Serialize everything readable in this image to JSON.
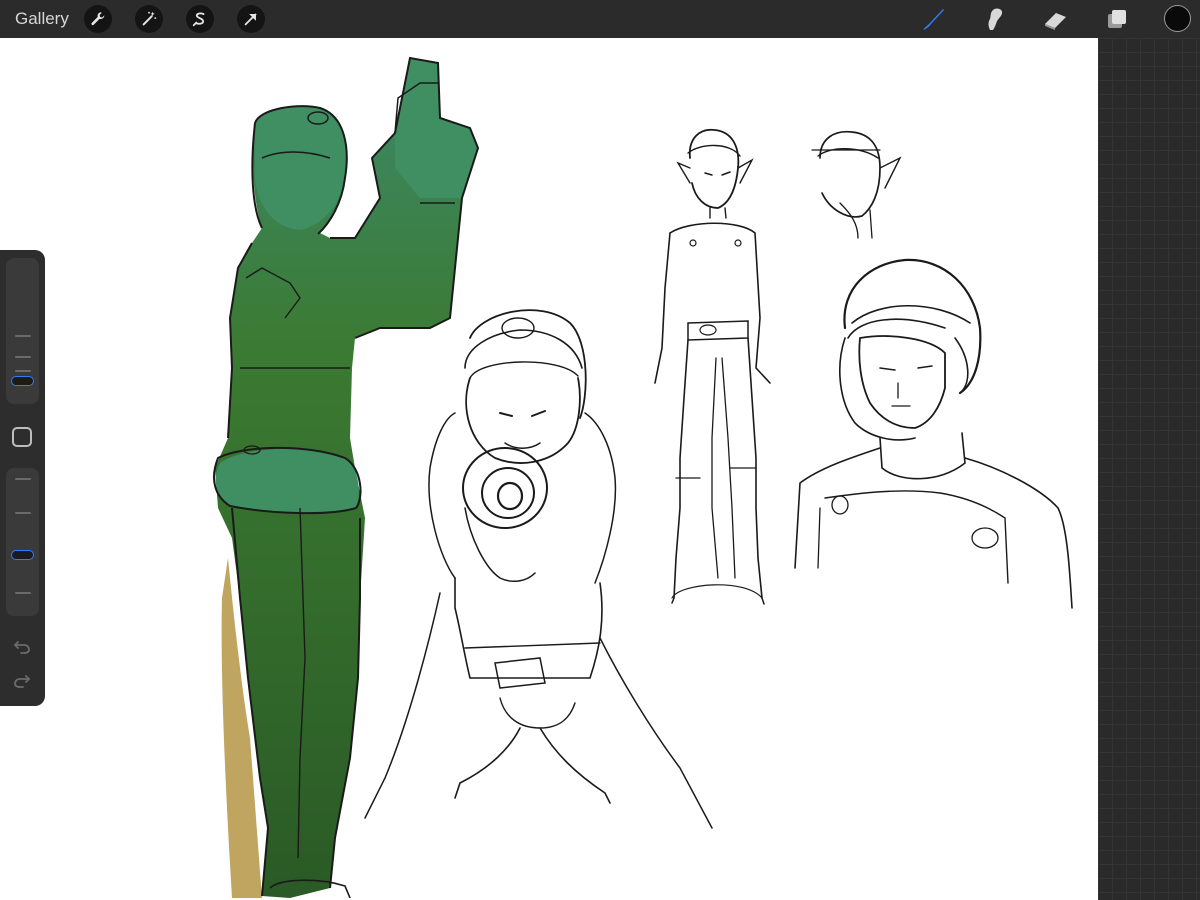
{
  "topbar": {
    "gallery_label": "Gallery",
    "left_tools": [
      "wrench-icon",
      "magic-wand-icon",
      "selection-s-icon",
      "transform-arrow-icon"
    ],
    "right_tools": [
      "brush-icon",
      "smudge-icon",
      "eraser-icon",
      "layers-icon"
    ],
    "active_tool": "brush-icon",
    "accent_color": "#2f7cf6",
    "current_color": "#0a0a0a"
  },
  "sidebar": {
    "size_slider_level": 0.1,
    "opacity_slider_level": 0.4,
    "modifier_icon": "square-modifier-icon",
    "undo_icon": "undo-arrow-icon",
    "redo_icon": "redo-arrow-icon"
  },
  "canvas": {
    "background": "#ffffff",
    "fill_colors": [
      "#2f6b2b",
      "#3f8f63",
      "#b89b4f"
    ]
  }
}
